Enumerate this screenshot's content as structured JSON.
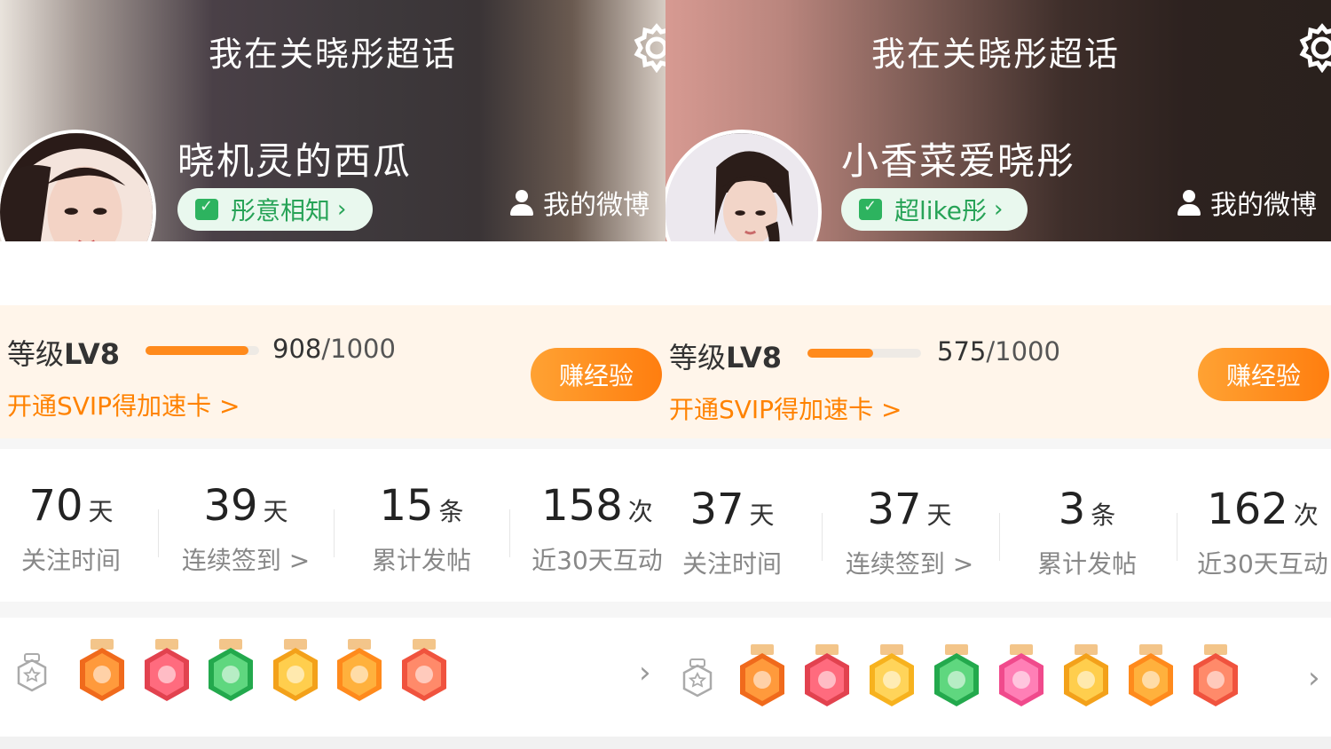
{
  "panels": [
    {
      "page_title": "我在关晓彤超话",
      "username": "晓机灵的西瓜",
      "title_badge": "彤意相知",
      "my_weibo": "我的微博",
      "level": {
        "label_prefix": "等级",
        "label_value": "LV8",
        "current": "908",
        "total": "/1000",
        "progress": 0.908
      },
      "svip_link": "开通SVIP得加速卡 >",
      "earn_button": "赚经验",
      "stats": [
        {
          "num": "70",
          "unit": "天",
          "label": "关注时间"
        },
        {
          "num": "39",
          "unit": "天",
          "label": "连续签到 >"
        },
        {
          "num": "15",
          "unit": "条",
          "label": "累计发帖"
        },
        {
          "num": "158",
          "unit": "次",
          "label": "近30天互动"
        }
      ],
      "badges": [
        "lv8-badge-icon",
        "trophy-badge-icon",
        "clap-badge-icon",
        "30-days-badge-icon",
        "cheer-badge-icon",
        "rock-hand-badge-icon"
      ]
    },
    {
      "page_title": "我在关晓彤超话",
      "username": "小香菜爱晓彤",
      "title_badge": "超like彤",
      "my_weibo": "我的微博",
      "level": {
        "label_prefix": "等级",
        "label_value": "LV8",
        "current": "575",
        "total": "/1000",
        "progress": 0.575
      },
      "svip_link": "开通SVIP得加速卡 >",
      "earn_button": "赚经验",
      "stats": [
        {
          "num": "37",
          "unit": "天",
          "label": "关注时间"
        },
        {
          "num": "37",
          "unit": "天",
          "label": "连续签到 >"
        },
        {
          "num": "3",
          "unit": "条",
          "label": "累计发帖"
        },
        {
          "num": "162",
          "unit": "次",
          "label": "近30天互动"
        }
      ],
      "badges": [
        "lv8-badge-icon",
        "trophy-badge-icon",
        "hi-badge-icon",
        "clap-badge-icon",
        "graduation-badge-icon",
        "30-days-badge-icon",
        "cheer-badge-icon",
        "rock-hand-badge-icon"
      ]
    }
  ],
  "colors": {
    "accent": "#ff8200",
    "green": "#27a357",
    "level_bg": "#fff5ea"
  }
}
